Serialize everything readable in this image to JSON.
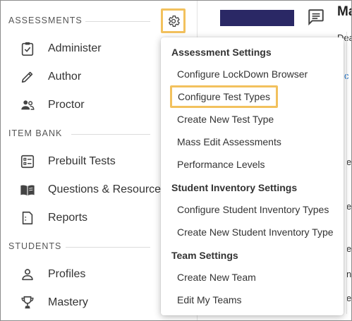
{
  "sidebar": {
    "sections": [
      {
        "title": "ASSESSMENTS",
        "items": [
          {
            "label": "Administer",
            "icon": "clipboard-check-icon"
          },
          {
            "label": "Author",
            "icon": "pencil-icon"
          },
          {
            "label": "Proctor",
            "icon": "people-icon"
          }
        ]
      },
      {
        "title": "ITEM BANK",
        "items": [
          {
            "label": "Prebuilt Tests",
            "icon": "checklist-icon"
          },
          {
            "label": "Questions & Resources",
            "icon": "open-book-icon"
          },
          {
            "label": "Reports",
            "icon": "report-document-icon"
          }
        ]
      },
      {
        "title": "STUDENTS",
        "items": [
          {
            "label": "Profiles",
            "icon": "person-icon"
          },
          {
            "label": "Mastery",
            "icon": "trophy-icon"
          }
        ]
      }
    ]
  },
  "settings_menu": {
    "groups": [
      {
        "heading": "Assessment Settings",
        "items": [
          "Configure LockDown Browser",
          "Configure Test Types",
          "Create New Test Type",
          "Mass Edit Assessments",
          "Performance Levels"
        ]
      },
      {
        "heading": "Student Inventory Settings",
        "items": [
          "Configure Student Inventory Types",
          "Create New Student Inventory Type"
        ]
      },
      {
        "heading": "Team Settings",
        "items": [
          "Create New Team",
          "Edit My Teams"
        ]
      }
    ],
    "highlighted_item": "Configure Test Types"
  },
  "right_pane": {
    "title_fragment": "Ma",
    "fragments": [
      "Dea",
      "c",
      "e",
      "e",
      "e",
      "n",
      "e"
    ]
  },
  "colors": {
    "highlight": "#f2c15d",
    "header_bar": "#2a2865",
    "link": "#1a6fc9"
  }
}
